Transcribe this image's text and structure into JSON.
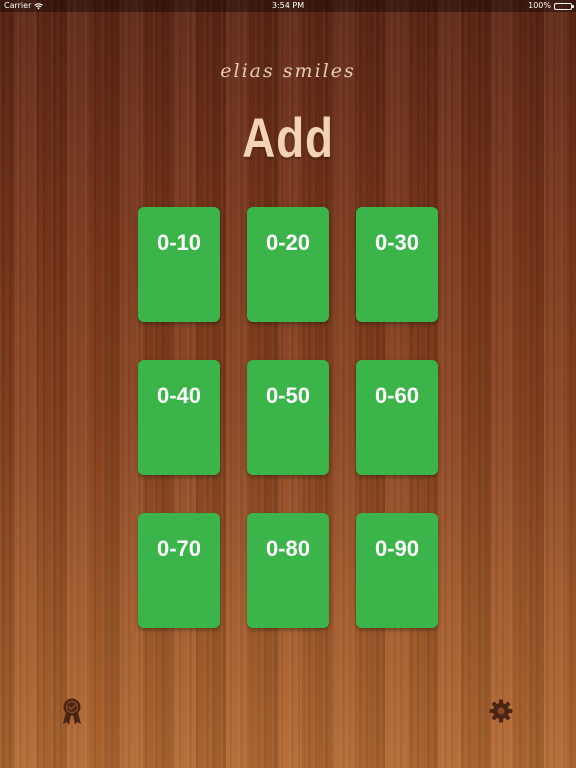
{
  "status_bar": {
    "carrier": "Carrier",
    "time": "3:54 PM",
    "battery": "100%"
  },
  "header": {
    "brand": "elias smiles",
    "title": "Add"
  },
  "ranges": [
    {
      "label": "0-10"
    },
    {
      "label": "0-20"
    },
    {
      "label": "0-30"
    },
    {
      "label": "0-40"
    },
    {
      "label": "0-50"
    },
    {
      "label": "0-60"
    },
    {
      "label": "0-70"
    },
    {
      "label": "0-80"
    },
    {
      "label": "0-90"
    }
  ],
  "icons": {
    "left": "award-icon",
    "right": "gear-icon"
  },
  "colors": {
    "card": "#3bb54a",
    "title": "#f2d3b4",
    "icon": "#4a2414"
  }
}
